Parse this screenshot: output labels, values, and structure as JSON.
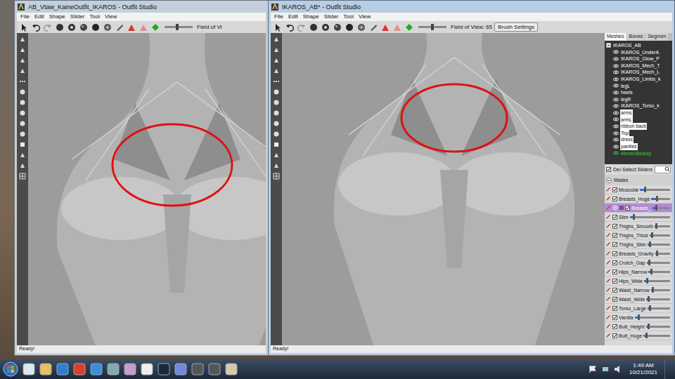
{
  "windows": [
    {
      "title": "AB_Vtaw_KaineOutfit_IKAROS - Outfit Studio",
      "active": false,
      "menu": [
        "File",
        "Edit",
        "Shape",
        "Slider",
        "Tool",
        "View"
      ],
      "fov_label": "Field of Vi",
      "fov_level": 0.4,
      "status": "Ready!"
    },
    {
      "title": "IKAROS_AB* - Outfit Studio",
      "active": true,
      "menu": [
        "File",
        "Edit",
        "Shape",
        "Slider",
        "Tool",
        "View"
      ],
      "fov_label": "Field of View: 65",
      "fov_level": 0.45,
      "brush_button": "Brush Settings",
      "status": "Ready!"
    }
  ],
  "meshes_panel": {
    "tabs": [
      {
        "label": "Meshes",
        "selected": true
      },
      {
        "label": "Bones",
        "selected": false
      },
      {
        "label": "Segmen",
        "selected": false
      }
    ],
    "root": "IKAROS_AB",
    "root_expanded": true,
    "items": [
      {
        "label": "IKAROS_UnderA",
        "selected": false,
        "color": "#ffffff"
      },
      {
        "label": "IKAROS_Glow_P",
        "selected": false,
        "color": "#ffffff"
      },
      {
        "label": "IKAROS_Mech_T",
        "selected": false,
        "color": "#ffffff"
      },
      {
        "label": "IKAROS_Mech_L",
        "selected": false,
        "color": "#ffffff"
      },
      {
        "label": "IKAROS_Limbs_k",
        "selected": false,
        "color": "#ffffff"
      },
      {
        "label": "legL",
        "selected": false,
        "color": "#ffffff"
      },
      {
        "label": "heels",
        "selected": false,
        "color": "#ffffff"
      },
      {
        "label": "legR",
        "selected": false,
        "color": "#ffffff"
      },
      {
        "label": "IKAROS_Torso_k",
        "selected": false,
        "color": "#ffffff"
      },
      {
        "label": "arms",
        "selected": true,
        "color": "#111111"
      },
      {
        "label": "armL",
        "selected": true,
        "color": "#111111"
      },
      {
        "label": "ribbon back",
        "selected": true,
        "color": "#111111"
      },
      {
        "label": "Top",
        "selected": true,
        "color": "#111111"
      },
      {
        "label": "dress",
        "selected": true,
        "color": "#111111"
      },
      {
        "label": "panties",
        "selected": true,
        "color": "#111111"
      },
      {
        "label": "AtomicBeauty",
        "selected": false,
        "color": "#33cc33"
      }
    ]
  },
  "sliders_panel": {
    "toggle_label": "De/-Select Sliders",
    "toggle_checked": true,
    "group": "Masks",
    "group_expanded": true,
    "sliders": [
      {
        "label": "Muscular",
        "checked": true,
        "selected": false,
        "level": 0.15
      },
      {
        "label": "Breasts_Huge",
        "checked": true,
        "selected": false,
        "level": 0.3
      },
      {
        "label": "Breasts_",
        "checked": true,
        "selected": true,
        "level": 0.2
      },
      {
        "label": "Slim",
        "checked": true,
        "selected": false,
        "level": 0.1
      },
      {
        "label": "Thighs_Smooth",
        "checked": true,
        "selected": false,
        "level": 0.1
      },
      {
        "label": "Thighs_Thick",
        "checked": true,
        "selected": false,
        "level": 0.1
      },
      {
        "label": "Thighs_Slim",
        "checked": true,
        "selected": false,
        "level": 0.1
      },
      {
        "label": "Breasts_Gravity",
        "checked": true,
        "selected": false,
        "level": 0.1
      },
      {
        "label": "Crotch_Gap",
        "checked": true,
        "selected": false,
        "level": 0.1
      },
      {
        "label": "Hips_Narrow",
        "checked": true,
        "selected": false,
        "level": 0.1
      },
      {
        "label": "Hips_Wide",
        "checked": true,
        "selected": false,
        "level": 0.1
      },
      {
        "label": "Waist_Narrow",
        "checked": true,
        "selected": false,
        "level": 0.1
      },
      {
        "label": "Waist_Wide",
        "checked": true,
        "selected": false,
        "level": 0.1
      },
      {
        "label": "Torso_Large",
        "checked": true,
        "selected": false,
        "level": 0.1
      },
      {
        "label": "Vanilla",
        "checked": true,
        "selected": false,
        "level": 0.1
      },
      {
        "label": "Butt_Height",
        "checked": true,
        "selected": false,
        "level": 0.1
      },
      {
        "label": "Butt_Huge",
        "checked": true,
        "selected": false,
        "level": 0.1
      }
    ]
  },
  "taskbar": {
    "time": "1:49 AM",
    "date": "10/21/2021"
  }
}
